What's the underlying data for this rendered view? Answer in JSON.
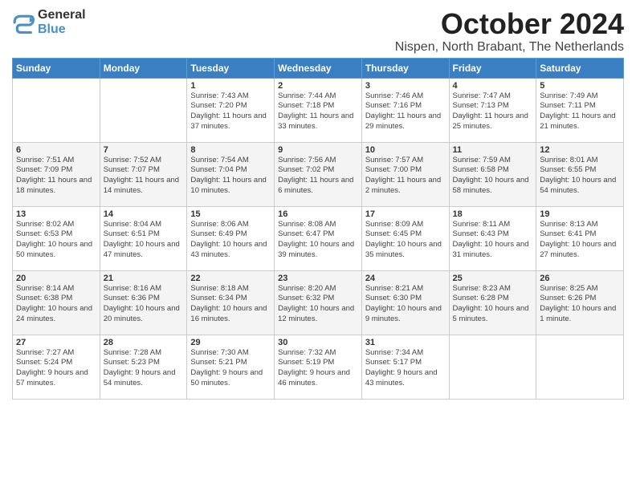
{
  "logo": {
    "line1": "General",
    "line2": "Blue"
  },
  "title": "October 2024",
  "subtitle": "Nispen, North Brabant, The Netherlands",
  "days_of_week": [
    "Sunday",
    "Monday",
    "Tuesday",
    "Wednesday",
    "Thursday",
    "Friday",
    "Saturday"
  ],
  "weeks": [
    [
      {
        "day": "",
        "info": ""
      },
      {
        "day": "",
        "info": ""
      },
      {
        "day": "1",
        "info": "Sunrise: 7:43 AM\nSunset: 7:20 PM\nDaylight: 11 hours and 37 minutes."
      },
      {
        "day": "2",
        "info": "Sunrise: 7:44 AM\nSunset: 7:18 PM\nDaylight: 11 hours and 33 minutes."
      },
      {
        "day": "3",
        "info": "Sunrise: 7:46 AM\nSunset: 7:16 PM\nDaylight: 11 hours and 29 minutes."
      },
      {
        "day": "4",
        "info": "Sunrise: 7:47 AM\nSunset: 7:13 PM\nDaylight: 11 hours and 25 minutes."
      },
      {
        "day": "5",
        "info": "Sunrise: 7:49 AM\nSunset: 7:11 PM\nDaylight: 11 hours and 21 minutes."
      }
    ],
    [
      {
        "day": "6",
        "info": "Sunrise: 7:51 AM\nSunset: 7:09 PM\nDaylight: 11 hours and 18 minutes."
      },
      {
        "day": "7",
        "info": "Sunrise: 7:52 AM\nSunset: 7:07 PM\nDaylight: 11 hours and 14 minutes."
      },
      {
        "day": "8",
        "info": "Sunrise: 7:54 AM\nSunset: 7:04 PM\nDaylight: 11 hours and 10 minutes."
      },
      {
        "day": "9",
        "info": "Sunrise: 7:56 AM\nSunset: 7:02 PM\nDaylight: 11 hours and 6 minutes."
      },
      {
        "day": "10",
        "info": "Sunrise: 7:57 AM\nSunset: 7:00 PM\nDaylight: 11 hours and 2 minutes."
      },
      {
        "day": "11",
        "info": "Sunrise: 7:59 AM\nSunset: 6:58 PM\nDaylight: 10 hours and 58 minutes."
      },
      {
        "day": "12",
        "info": "Sunrise: 8:01 AM\nSunset: 6:55 PM\nDaylight: 10 hours and 54 minutes."
      }
    ],
    [
      {
        "day": "13",
        "info": "Sunrise: 8:02 AM\nSunset: 6:53 PM\nDaylight: 10 hours and 50 minutes."
      },
      {
        "day": "14",
        "info": "Sunrise: 8:04 AM\nSunset: 6:51 PM\nDaylight: 10 hours and 47 minutes."
      },
      {
        "day": "15",
        "info": "Sunrise: 8:06 AM\nSunset: 6:49 PM\nDaylight: 10 hours and 43 minutes."
      },
      {
        "day": "16",
        "info": "Sunrise: 8:08 AM\nSunset: 6:47 PM\nDaylight: 10 hours and 39 minutes."
      },
      {
        "day": "17",
        "info": "Sunrise: 8:09 AM\nSunset: 6:45 PM\nDaylight: 10 hours and 35 minutes."
      },
      {
        "day": "18",
        "info": "Sunrise: 8:11 AM\nSunset: 6:43 PM\nDaylight: 10 hours and 31 minutes."
      },
      {
        "day": "19",
        "info": "Sunrise: 8:13 AM\nSunset: 6:41 PM\nDaylight: 10 hours and 27 minutes."
      }
    ],
    [
      {
        "day": "20",
        "info": "Sunrise: 8:14 AM\nSunset: 6:38 PM\nDaylight: 10 hours and 24 minutes."
      },
      {
        "day": "21",
        "info": "Sunrise: 8:16 AM\nSunset: 6:36 PM\nDaylight: 10 hours and 20 minutes."
      },
      {
        "day": "22",
        "info": "Sunrise: 8:18 AM\nSunset: 6:34 PM\nDaylight: 10 hours and 16 minutes."
      },
      {
        "day": "23",
        "info": "Sunrise: 8:20 AM\nSunset: 6:32 PM\nDaylight: 10 hours and 12 minutes."
      },
      {
        "day": "24",
        "info": "Sunrise: 8:21 AM\nSunset: 6:30 PM\nDaylight: 10 hours and 9 minutes."
      },
      {
        "day": "25",
        "info": "Sunrise: 8:23 AM\nSunset: 6:28 PM\nDaylight: 10 hours and 5 minutes."
      },
      {
        "day": "26",
        "info": "Sunrise: 8:25 AM\nSunset: 6:26 PM\nDaylight: 10 hours and 1 minute."
      }
    ],
    [
      {
        "day": "27",
        "info": "Sunrise: 7:27 AM\nSunset: 5:24 PM\nDaylight: 9 hours and 57 minutes."
      },
      {
        "day": "28",
        "info": "Sunrise: 7:28 AM\nSunset: 5:23 PM\nDaylight: 9 hours and 54 minutes."
      },
      {
        "day": "29",
        "info": "Sunrise: 7:30 AM\nSunset: 5:21 PM\nDaylight: 9 hours and 50 minutes."
      },
      {
        "day": "30",
        "info": "Sunrise: 7:32 AM\nSunset: 5:19 PM\nDaylight: 9 hours and 46 minutes."
      },
      {
        "day": "31",
        "info": "Sunrise: 7:34 AM\nSunset: 5:17 PM\nDaylight: 9 hours and 43 minutes."
      },
      {
        "day": "",
        "info": ""
      },
      {
        "day": "",
        "info": ""
      }
    ]
  ]
}
